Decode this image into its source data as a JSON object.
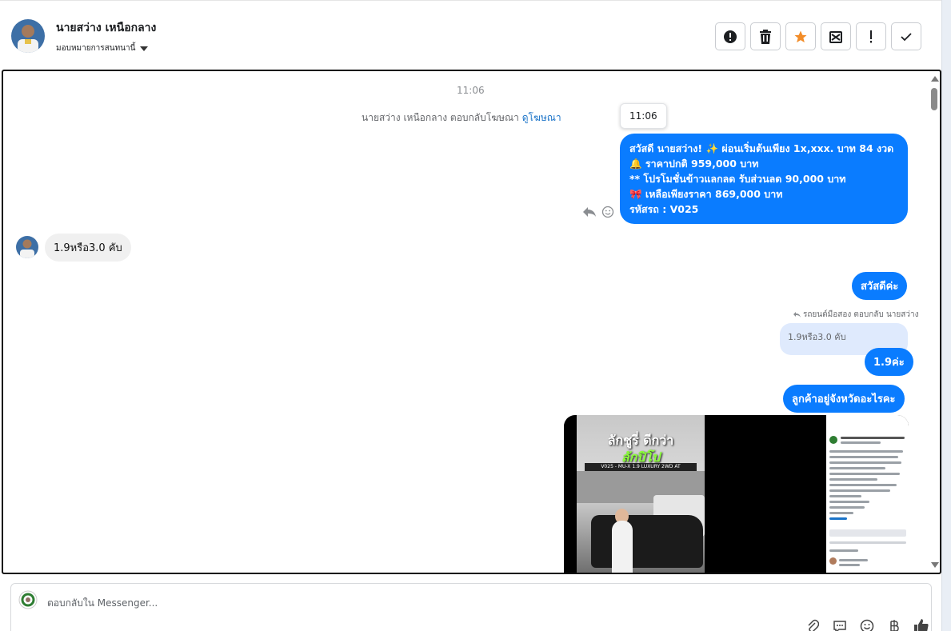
{
  "header": {
    "contact_name": "นายสว่าง เหนือกลาง",
    "assign_label": "มอบหมายการสนทนานี้",
    "actions": [
      {
        "name": "mark-spam-button",
        "icon": "exclamation-circle-icon"
      },
      {
        "name": "delete-button",
        "icon": "trash-icon"
      },
      {
        "name": "star-button",
        "icon": "star-icon",
        "color": "#f28c28"
      },
      {
        "name": "mark-unread-button",
        "icon": "envelope-x-icon"
      },
      {
        "name": "follow-up-button",
        "icon": "exclamation-icon"
      },
      {
        "name": "mark-done-button",
        "icon": "check-icon"
      }
    ]
  },
  "chat": {
    "timestamp_top": "11:06",
    "system_line": {
      "text": "นายสว่าง เหนือกลาง ตอบกลับโฆษณา",
      "link": "ดูโฆษณา"
    },
    "tooltip_time": "11:06",
    "ad_message": "สวัสดี นายสว่าง! ✨  ผ่อนเริ่มต้นเพียง 1x,xxx. บาท 84 งวด\n🔔 ราคาปกติ 959,000 บาท\n** โปรโมชั่นข้าวแลกลด รับส่วนลด 90,000 บาท\n🎀  เหลือเพียงราคา 869,000 บาท\n รหัสรถ : V025",
    "incoming_message": "1.9หรือ3.0 คับ",
    "outgoing_greeting": "สวัสดีค่ะ",
    "reply_context": "รถยนต์มือสอง ตอบกลับ นายสว่าง",
    "quoted_text": "1.9หรือ3.0 คับ",
    "reply_answer": "1.9ค่ะ",
    "province_question": "ลูกค้าอยู่จังหวัดอะไรคะ",
    "video_title": "ลักชูรี่ ดีกว่า",
    "video_subtitle": "ลักปิโป",
    "video_band": "V025 - MU-X 1.9 LUXURY 2WD AT"
  },
  "composer": {
    "placeholder": "ตอบกลับใน Messenger...",
    "icons": [
      "paperclip-icon",
      "saved-reply-icon",
      "emoji-icon",
      "baht-icon",
      "like-icon"
    ]
  },
  "colors": {
    "accent": "#0a7cff",
    "star": "#f28c28",
    "quote_bg": "#dfeafd"
  }
}
